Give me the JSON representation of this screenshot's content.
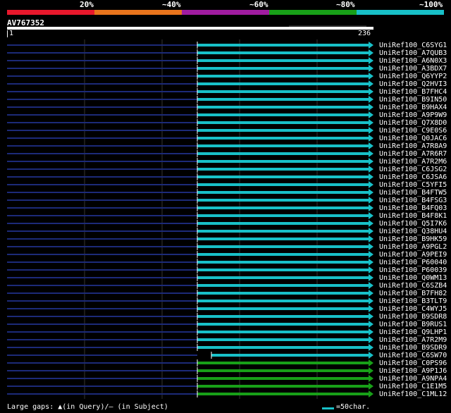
{
  "legend": {
    "labels": [
      "20%",
      "~40%",
      "~60%",
      "~80%",
      "~100%"
    ],
    "colors": [
      "#e8182c",
      "#e8741c",
      "#a01ca0",
      "#18a018",
      "#18c0c8"
    ]
  },
  "query": {
    "name": "AV767352",
    "start": "1",
    "end": "236"
  },
  "hits": [
    {
      "name": "UniRef100_C6SYG1",
      "color": "#18c0c8"
    },
    {
      "name": "UniRef100_A7QUB3",
      "color": "#18c0c8"
    },
    {
      "name": "UniRef100_A6N0X3",
      "color": "#18c0c8"
    },
    {
      "name": "UniRef100_A3BDX7",
      "color": "#18c0c8"
    },
    {
      "name": "UniRef100_Q6YYP2",
      "color": "#18c0c8"
    },
    {
      "name": "UniRef100_Q2HVI3",
      "color": "#18c0c8"
    },
    {
      "name": "UniRef100_B7FHC4",
      "color": "#18c0c8"
    },
    {
      "name": "UniRef100_B9IN50",
      "color": "#18c0c8"
    },
    {
      "name": "UniRef100_B9HAX4",
      "color": "#18c0c8"
    },
    {
      "name": "UniRef100_A9P9W9",
      "color": "#18c0c8"
    },
    {
      "name": "UniRef100_Q7X8D0",
      "color": "#18c0c8"
    },
    {
      "name": "UniRef100_C9E0S6",
      "color": "#18c0c8"
    },
    {
      "name": "UniRef100_Q0JAC6",
      "color": "#18c0c8"
    },
    {
      "name": "UniRef100_A7R8A9",
      "color": "#18c0c8"
    },
    {
      "name": "UniRef100_A7R6R7",
      "color": "#18c0c8"
    },
    {
      "name": "UniRef100_A7R2M6",
      "color": "#18c0c8"
    },
    {
      "name": "UniRef100_C6JSG2",
      "color": "#18c0c8"
    },
    {
      "name": "UniRef100_C6JSA6",
      "color": "#18c0c8"
    },
    {
      "name": "UniRef100_C5YFI5",
      "color": "#18c0c8"
    },
    {
      "name": "UniRef100_B4FTW5",
      "color": "#18c0c8"
    },
    {
      "name": "UniRef100_B4FSG3",
      "color": "#18c0c8"
    },
    {
      "name": "UniRef100_B4FQ03",
      "color": "#18c0c8"
    },
    {
      "name": "UniRef100_B4F8K1",
      "color": "#18c0c8"
    },
    {
      "name": "UniRef100_Q5I7K6",
      "color": "#18c0c8"
    },
    {
      "name": "UniRef100_Q38HU4",
      "color": "#18c0c8"
    },
    {
      "name": "UniRef100_B9HK59",
      "color": "#18c0c8"
    },
    {
      "name": "UniRef100_A9PGL2",
      "color": "#18c0c8"
    },
    {
      "name": "UniRef100_A9PEI9",
      "color": "#18c0c8"
    },
    {
      "name": "UniRef100_P60040",
      "color": "#18c0c8"
    },
    {
      "name": "UniRef100_P60039",
      "color": "#18c0c8"
    },
    {
      "name": "UniRef100_Q0WM13",
      "color": "#18c0c8"
    },
    {
      "name": "UniRef100_C6SZB4",
      "color": "#18c0c8"
    },
    {
      "name": "UniRef100_B7FH82",
      "color": "#18c0c8"
    },
    {
      "name": "UniRef100_B3TLT9",
      "color": "#18c0c8"
    },
    {
      "name": "UniRef100_C4WYJ5",
      "color": "#18c0c8"
    },
    {
      "name": "UniRef100_B9SDR8",
      "color": "#18c0c8"
    },
    {
      "name": "UniRef100_B9RUS1",
      "color": "#18c0c8"
    },
    {
      "name": "UniRef100_Q9LHP1",
      "color": "#18c0c8"
    },
    {
      "name": "UniRef100_A7R2M9",
      "color": "#18c0c8"
    },
    {
      "name": "UniRef100_B9SDR9",
      "color": "#18c0c8"
    },
    {
      "name": "UniRef100_C6SW70",
      "color": "#18c0c8"
    },
    {
      "name": "UniRef100_C0PS96",
      "color": "#18a018"
    },
    {
      "name": "UniRef100_A9P1J6",
      "color": "#18a018"
    },
    {
      "name": "UniRef100_A9NPA4",
      "color": "#18a018"
    },
    {
      "name": "UniRef100_C1E1M5",
      "color": "#18a018"
    },
    {
      "name": "UniRef100_C1ML12",
      "color": "#18a018"
    }
  ],
  "footer": {
    "gaps_text": "Large gaps: ▲(in Query)/— (in Subject)",
    "scale_text": "=50char."
  },
  "colors": {
    "unaligned": "#1c2a78",
    "gridline": "#333333"
  }
}
